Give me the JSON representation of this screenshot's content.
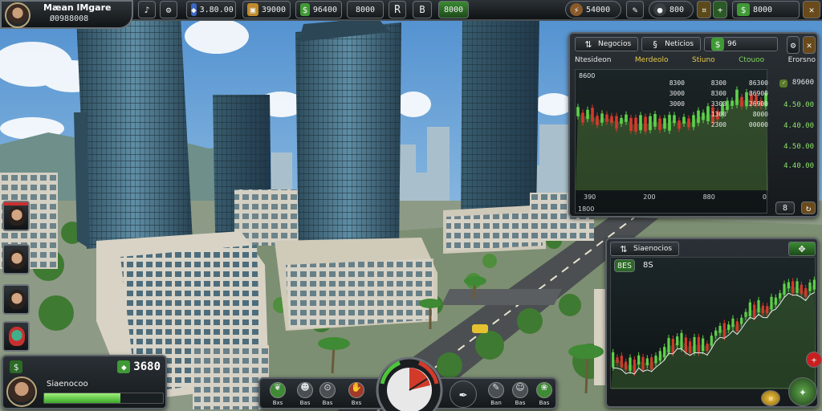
{
  "profile": {
    "name": "Mæan lMgare",
    "cash": "Ø0988008"
  },
  "topbar": {
    "res_gem": "3.80.00",
    "res_crate": "39000",
    "res_cash": "96400",
    "center_value": "8000",
    "center_letter": "R",
    "center_b": "B",
    "center_cash": "8000",
    "right_a": "54000",
    "right_b": "800",
    "right_cash": "8000"
  },
  "market": {
    "tabs": [
      "Negocios",
      "Neticios",
      "96"
    ],
    "columns": [
      "Ntesideon",
      "Merdeolo",
      "Stiuno",
      "Ctouoo",
      "Erorsno"
    ],
    "rows": [
      [
        "8300",
        "8300",
        "86300"
      ],
      [
        "3000",
        "8300",
        "86900"
      ],
      [
        "3000",
        "3300",
        "26900"
      ],
      [
        "",
        "1300",
        "8000"
      ],
      [
        "",
        "2300",
        "00000"
      ]
    ],
    "side_values": [
      "89600",
      "4.50.00",
      "4.40.00",
      "4.50.00",
      "4.40.00"
    ],
    "chart_top": "8600",
    "x_ticks": [
      "390",
      "200",
      "880",
      "0"
    ],
    "footer": "1800",
    "footer_x": "8"
  },
  "chart2": {
    "title": "Siaenocios",
    "badge": "8ES",
    "stat": "8S"
  },
  "money": {
    "amount": "3680",
    "account": "Siaenocoo",
    "progress": 0.64
  },
  "toolbar": {
    "labels": [
      "Bxs",
      "Bas",
      "Bas",
      "Bxs",
      "Ban",
      "Bas",
      "Bas"
    ]
  },
  "colors": {
    "up": "#5ed14a",
    "down": "#d23a2a",
    "accent": "#e8c94a",
    "panel": "#1c2023"
  }
}
